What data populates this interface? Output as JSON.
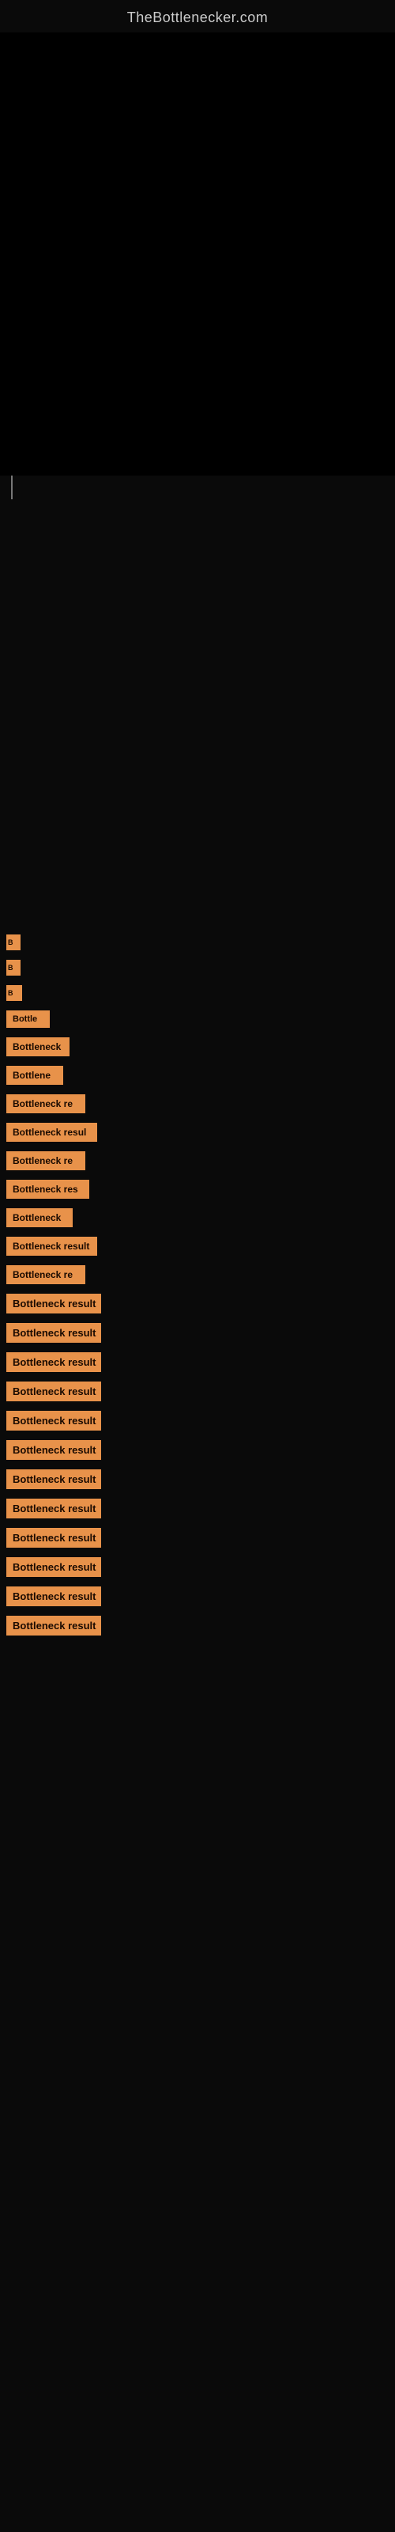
{
  "site": {
    "title": "TheBottlenecker.com"
  },
  "results": [
    {
      "id": 1,
      "label": "B",
      "width_class": "w1"
    },
    {
      "id": 2,
      "label": "B",
      "width_class": "w2"
    },
    {
      "id": 3,
      "label": "B",
      "width_class": "w3"
    },
    {
      "id": 4,
      "label": "Bottle",
      "width_class": "w4"
    },
    {
      "id": 5,
      "label": "Bottleneck",
      "width_class": "w5"
    },
    {
      "id": 6,
      "label": "Bottlene",
      "width_class": "w6"
    },
    {
      "id": 7,
      "label": "Bottleneck re",
      "width_class": "w7"
    },
    {
      "id": 8,
      "label": "Bottleneck resul",
      "width_class": "w8"
    },
    {
      "id": 9,
      "label": "Bottleneck re",
      "width_class": "w9"
    },
    {
      "id": 10,
      "label": "Bottleneck res",
      "width_class": "w10"
    },
    {
      "id": 11,
      "label": "Bottleneck",
      "width_class": "w11"
    },
    {
      "id": 12,
      "label": "Bottleneck result",
      "width_class": "w12"
    },
    {
      "id": 13,
      "label": "Bottleneck re",
      "width_class": "w13"
    },
    {
      "id": 14,
      "label": "Bottleneck result",
      "width_class": "w14"
    },
    {
      "id": 15,
      "label": "Bottleneck result",
      "width_class": "w15"
    },
    {
      "id": 16,
      "label": "Bottleneck result",
      "width_class": "w16"
    },
    {
      "id": 17,
      "label": "Bottleneck result",
      "width_class": "w17"
    },
    {
      "id": 18,
      "label": "Bottleneck result",
      "width_class": "w18"
    },
    {
      "id": 19,
      "label": "Bottleneck result",
      "width_class": "w19"
    },
    {
      "id": 20,
      "label": "Bottleneck result",
      "width_class": "w20"
    },
    {
      "id": 21,
      "label": "Bottleneck result",
      "width_class": "w21"
    },
    {
      "id": 22,
      "label": "Bottleneck result",
      "width_class": "w22"
    },
    {
      "id": 23,
      "label": "Bottleneck result",
      "width_class": "w23"
    },
    {
      "id": 24,
      "label": "Bottleneck result",
      "width_class": "w24"
    },
    {
      "id": 25,
      "label": "Bottleneck result",
      "width_class": "w25"
    }
  ]
}
